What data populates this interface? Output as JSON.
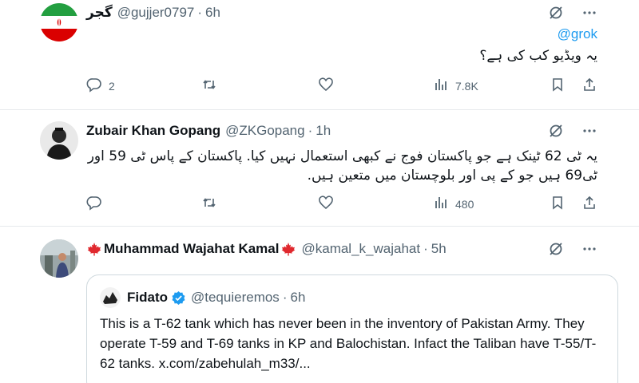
{
  "tweets": [
    {
      "display_name": "گجر",
      "handle": "@gujjer0797",
      "time": "6h",
      "mention": "@grok",
      "text": "یہ ویڈیو کب کی ہے؟",
      "replies": "2",
      "retweets": "",
      "likes": "",
      "views": "7.8K"
    },
    {
      "display_name": "Zubair Khan Gopang",
      "handle": "@ZKGopang",
      "time": "1h",
      "text": "یہ ٹی 62 ٹینک ہے جو پاکستان فوج نے کبھی استعمال نہیں کیا. پاکستان کے پاس ٹی 59 اور ٹی69 ہیں جو کے پی اور بلوچستان میں متعین ہیں.",
      "replies": "",
      "retweets": "",
      "likes": "",
      "views": "480"
    },
    {
      "display_name": "Muhammad Wajahat Kamal",
      "handle": "@kamal_k_wajahat",
      "time": "5h",
      "quote": {
        "display_name": "Fidato",
        "handle": "@tequieremos",
        "time": "6h",
        "text": "This is a T-62 tank which has never been in the inventory of Pakistan Army. They operate T-59 and T-69 tanks in KP and Balochistan. Infact the Taliban have T-55/T-62 tanks. x.com/zabehulah_m33/..."
      }
    }
  ],
  "separator": "·",
  "colors": {
    "link": "#1d9bf0",
    "muted": "#536471",
    "border": "#cfd9de",
    "verified": "#1d9bf0",
    "flag_maple": "#e0282e"
  },
  "icons": [
    "grok-icon",
    "more-icon",
    "reply-icon",
    "retweet-icon",
    "like-icon",
    "views-icon",
    "bookmark-icon",
    "share-icon",
    "verified-badge-icon",
    "maple-leaf-icon"
  ]
}
